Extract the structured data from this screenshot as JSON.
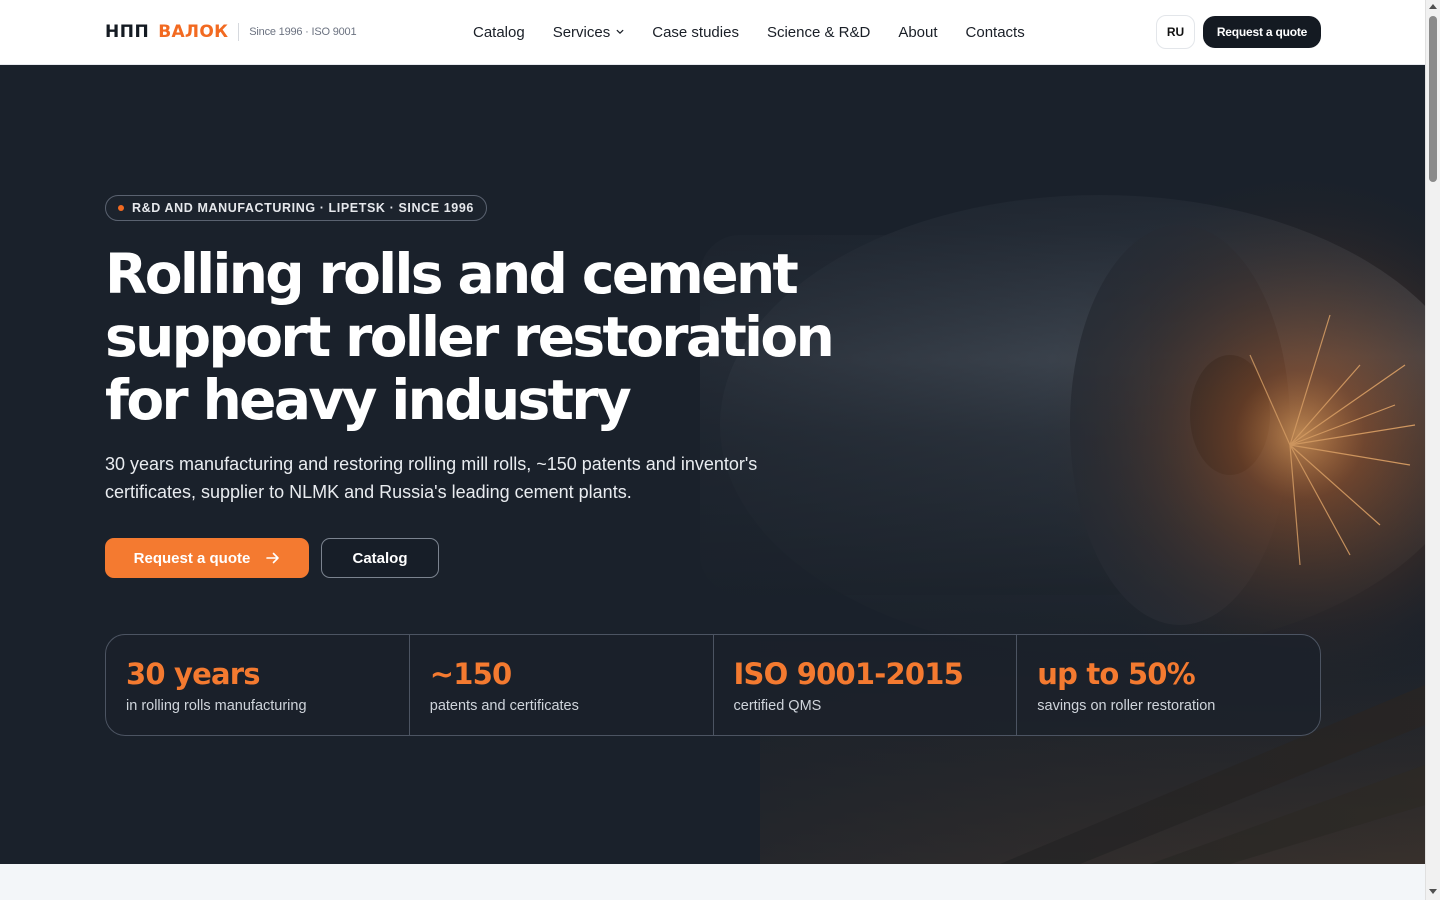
{
  "header": {
    "logo_primary": "НПП",
    "logo_accent": "ВАЛОК",
    "since": "Since 1996 · ISO 9001",
    "nav": [
      {
        "label": "Catalog"
      },
      {
        "label": "Services"
      },
      {
        "label": "Case studies"
      },
      {
        "label": "Science & R&D"
      },
      {
        "label": "About"
      },
      {
        "label": "Contacts"
      }
    ],
    "lang": "RU",
    "cta": "Request a quote"
  },
  "hero": {
    "badge": "R&D AND MANUFACTURING · LIPETSK · SINCE 1996",
    "title_lines": [
      "Rolling rolls and cement",
      "support roller restoration",
      "for heavy industry"
    ],
    "subtitle": "30 years manufacturing and restoring rolling mill rolls, ~150 patents and inventor's certificates, supplier to NLMK and Russia's leading cement plants.",
    "primary_button": "Request a quote",
    "secondary_button": "Catalog",
    "stats": [
      {
        "value": "30 years",
        "label": "in rolling rolls manufacturing"
      },
      {
        "value": "~150",
        "label": "patents and certificates"
      },
      {
        "value": "ISO 9001-2015",
        "label": "certified QMS"
      },
      {
        "value": "up to 50%",
        "label": "savings on roller restoration"
      }
    ]
  },
  "colors": {
    "accent": "#f47a30",
    "brand_orange": "#f26a21",
    "dark": "#141a22",
    "hero_bg": "#1a212b"
  },
  "icons": {
    "services_chevron": "chevron-down-icon",
    "quote_arrow": "arrow-right-icon",
    "badge_dot": "dot-icon"
  }
}
